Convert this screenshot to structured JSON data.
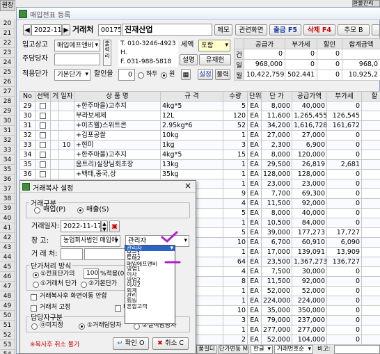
{
  "outer": {
    "top_left_tab": "원장",
    "top_right_tab": "환불관리",
    "row_numbers": [
      "20",
      "21",
      "22",
      "23",
      "24",
      "25",
      "26",
      "27",
      "28",
      "29",
      "30",
      "31",
      "32",
      "33",
      "34",
      "35",
      "36",
      "37",
      "38",
      "39",
      "40",
      "41",
      "42",
      "43",
      "44",
      "45",
      "46",
      "47",
      "48",
      "49",
      "50",
      "51",
      "52",
      "53",
      "54",
      "55"
    ]
  },
  "window": {
    "title": "매입전표 등록",
    "close": "×"
  },
  "header": {
    "date": "2022-11",
    "trade_label": "거래처",
    "trade_code": "001753",
    "trade_name": "진재산업",
    "memo_btn": "메모",
    "btn_related": "관련화면",
    "btn_out": "출금 F5",
    "btn_delete": "삭제 F4",
    "btn_add": "추모 B",
    "inout_label": "입고상고",
    "inout_value": "매입에프앤비",
    "supplier_label": "주담당자",
    "tax_label": "세액",
    "tax_value": "포함",
    "phone_t": "T. 010-3246-4923",
    "phone_h": "H.",
    "phone_f": "F. 031-988-5818",
    "btn_desc": "설명",
    "btn_biz": "유재헌",
    "price_label": "적용단가",
    "price_value": "기본단가",
    "discount_label": "할인율",
    "discount_value": "0",
    "discount_opt1": "하두",
    "discount_opt2": "원",
    "btn_set": "설정",
    "btn_sub": "물력"
  },
  "summary": {
    "headers": [
      "공급가",
      "부가세",
      "할인",
      "합계금액"
    ],
    "rows": [
      {
        "label": "건",
        "values": [
          "0",
          "0",
          "0",
          ""
        ]
      },
      {
        "label": "일",
        "values": [
          "968,000",
          "0",
          "0",
          "968,0"
        ]
      },
      {
        "label": "월",
        "values": [
          "10,422,759",
          "502,441",
          "0",
          "10,925,2"
        ]
      }
    ]
  },
  "grid": {
    "headers": [
      "No",
      "선택",
      "거래",
      "일자",
      "상 품 명",
      "규 격",
      "수량",
      "단위",
      "단 가",
      "공급가액",
      "부가세",
      "할"
    ],
    "rows": [
      {
        "no": "29",
        "day": "",
        "name": "+한주마을)고추지",
        "spec": "4kg*5",
        "qty": "5",
        "unit": "EA",
        "price": "8,000",
        "supply": "40,000",
        "vat": "0"
      },
      {
        "no": "30",
        "day": "",
        "name": "부라보세제",
        "spec": "12L",
        "qty": "120",
        "unit": "EA",
        "price": "11,600",
        "supply": "1,265,455",
        "vat": "126,545"
      },
      {
        "no": "31",
        "day": "",
        "name": "+이츠웰)스위트콘",
        "spec": "2.95kg*6",
        "qty": "52",
        "unit": "EA",
        "price": "34,200",
        "supply": "1,616,728",
        "vat": "161,672"
      },
      {
        "no": "32",
        "day": "",
        "name": "+김포공쌀",
        "spec": "10kg",
        "qty": "1",
        "unit": "EA",
        "price": "27,000",
        "supply": "27,000",
        "vat": "0"
      },
      {
        "no": "33",
        "day": "10",
        "name": "+현미",
        "spec": "1kg",
        "qty": "3",
        "unit": "EA",
        "price": "2,300",
        "supply": "6,900",
        "vat": "0"
      },
      {
        "no": "34",
        "day": "",
        "name": "+한주마을)고추지",
        "spec": "4kg*5",
        "qty": "15",
        "unit": "EA",
        "price": "8,000",
        "supply": "120,000",
        "vat": "0"
      },
      {
        "no": "35",
        "day": "",
        "name": "움트리)실장님회초장",
        "spec": "13kg",
        "qty": "1",
        "unit": "EA",
        "price": "29,500",
        "supply": "26,819",
        "vat": "2,681"
      },
      {
        "no": "36",
        "day": "",
        "name": "+백태,중국,상",
        "spec": "35kg",
        "qty": "1",
        "unit": "EA",
        "price": "128,000",
        "supply": "128,000",
        "vat": "0"
      },
      {
        "no": "37",
        "day": "",
        "name": "+수정쌀,교통",
        "spec": "10kg",
        "qty": "1",
        "unit": "EA",
        "price": "23,000",
        "supply": "23,000",
        "vat": "0"
      },
      {
        "no": "38",
        "day": "",
        "name": "",
        "spec": "g",
        "qty": "9",
        "unit": "EA",
        "price": "7,700",
        "supply": "69,300",
        "vat": "0"
      },
      {
        "no": "39",
        "day": "",
        "name": "",
        "spec": "g",
        "qty": "4",
        "unit": "EA",
        "price": "11,500",
        "supply": "92,000",
        "vat": "0"
      },
      {
        "no": "40",
        "day": "",
        "name": "",
        "spec": "g",
        "qty": "5",
        "unit": "EA",
        "price": "8,000",
        "supply": "40,000",
        "vat": "0"
      },
      {
        "no": "41",
        "day": "",
        "name": "",
        "spec": "g",
        "qty": "1",
        "unit": "EA",
        "price": "10,500",
        "supply": "84,000",
        "vat": "0"
      },
      {
        "no": "42",
        "day": "",
        "name": "",
        "spec": "g*6박스",
        "qty": "5",
        "unit": "EA",
        "price": "39,000",
        "supply": "177,273",
        "vat": "17,727"
      },
      {
        "no": "43",
        "day": "",
        "name": "",
        "spec": "g*10",
        "qty": "10",
        "unit": "EA",
        "price": "6,700",
        "supply": "60,910",
        "vat": "6,090"
      },
      {
        "no": "44",
        "day": "",
        "name": "",
        "spec": "",
        "qty": "1",
        "unit": "EA",
        "price": "17,000",
        "supply": "139,091",
        "vat": "13,909"
      },
      {
        "no": "45",
        "day": "",
        "name": "",
        "spec": "",
        "qty": "64",
        "unit": "EA",
        "price": "23,500",
        "supply": "1,367,273",
        "vat": "136,727"
      },
      {
        "no": "46",
        "day": "",
        "name": "",
        "spec": "",
        "qty": "4",
        "unit": "EA",
        "price": "7,500",
        "supply": "30,000",
        "vat": "0"
      },
      {
        "no": "47",
        "day": "",
        "name": "",
        "spec": "",
        "qty": "8",
        "unit": "EA",
        "price": "11,500",
        "supply": "92,000",
        "vat": "0"
      },
      {
        "no": "48",
        "day": "",
        "name": "",
        "spec": "",
        "qty": "1",
        "unit": "EA",
        "price": "52,000",
        "supply": "52,000",
        "vat": "0"
      },
      {
        "no": "49",
        "day": "",
        "name": "",
        "spec": "",
        "qty": "1",
        "unit": "EA",
        "price": "224,000",
        "supply": "224,000",
        "vat": "0"
      },
      {
        "no": "50",
        "day": "",
        "name": "",
        "spec": "",
        "qty": "10",
        "unit": "EA",
        "price": "35,000",
        "supply": "350,000",
        "vat": "0"
      },
      {
        "no": "51",
        "day": "",
        "name": "",
        "spec": "",
        "qty": "3",
        "unit": "EA",
        "price": "79,000",
        "supply": "237,000",
        "vat": "0"
      },
      {
        "no": "52",
        "day": "",
        "name": "",
        "spec": "",
        "qty": "1",
        "unit": "EA",
        "price": "277,000",
        "supply": "277,000",
        "vat": "0"
      },
      {
        "no": "53",
        "day": "",
        "name": "",
        "spec": "",
        "qty": "2",
        "unit": "EA",
        "price": "52,000",
        "supply": "104,000",
        "vat": "0"
      }
    ],
    "extra_rows": [
      "54",
      "55"
    ]
  },
  "bottom": {
    "btn_filter": "품필터",
    "btn_price": "단가변동 M",
    "lang": "한글",
    "trade_no": "거래번호순",
    "note": "비고:"
  },
  "dialog": {
    "title": "거래복사 설정",
    "close": "×",
    "group_trade": "거래구분",
    "opt_buy": "매입(P)",
    "opt_sell": "매출(S)",
    "date_label": "거래일자:",
    "date_value": "2022-11-17",
    "warehouse_label": "창  고:",
    "warehouse_value": "농업회사법인 매입에",
    "manager_value": "관리자",
    "client_label": "거 래 처:",
    "group_price": "단가처리 방식",
    "price_opt1": "①전표단가의",
    "price_pct": "100",
    "price_suffix": "%적용(0",
    "price_opt2": "①거래처 단가",
    "price_opt3": "②기본단가",
    "chk_move": "거래복사후 화면이동 안함",
    "chk_fix": "거래처 고정",
    "chk_b": "비",
    "group_staff": "담당자구분",
    "staff_opt0": "⓪미지정",
    "staff_opt1": "①거래담당자",
    "staff_opt2": "②실적담당자",
    "warning": "※복사후 취소 불가",
    "ok": "확인 O",
    "cancel": "취소 C"
  },
  "dropdown": {
    "items": [
      "관리자",
      "물류1",
      "도매2",
      "매입에프앤비",
      "영업1",
      "이사",
      "영업2",
      "이사2",
      "회계",
      "관리",
      "회원",
      "혼합고객"
    ],
    "selected": 0
  },
  "colors": {
    "title_blue": "#2a64c5",
    "annotation_purple": "#b21ccc",
    "red_btn": "#cc0000",
    "blue_btn": "#1a3aa8"
  }
}
